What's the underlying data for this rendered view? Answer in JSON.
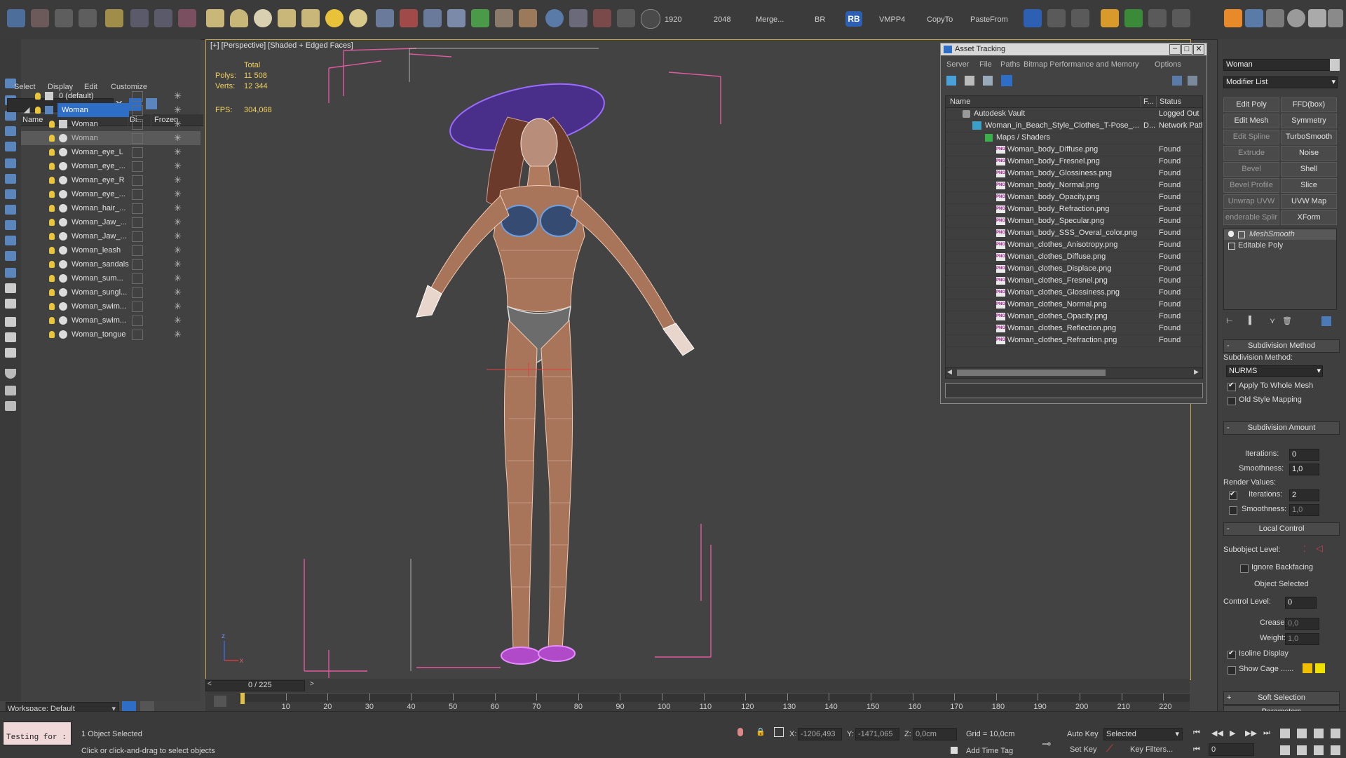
{
  "toolbar": {
    "res_a": "1920",
    "res_b": "2048",
    "merge": "Merge...",
    "br": "BR",
    "rb": "RB",
    "vmpp": "VMPP4",
    "copyto": "CopyTo",
    "pastefrom": "PasteFrom"
  },
  "scene_explorer": {
    "menu": [
      "Select",
      "Display",
      "Edit",
      "Customize"
    ],
    "col_name": "Name",
    "col_display": "Di...",
    "col_frozen": "Frozen",
    "rows": [
      {
        "name": "0 (default)"
      },
      {
        "name": "Woman"
      },
      {
        "name": "Woman"
      },
      {
        "name": "Woman"
      },
      {
        "name": "Woman_eye_L"
      },
      {
        "name": "Woman_eye_..."
      },
      {
        "name": "Woman_eye_R"
      },
      {
        "name": "Woman_eye_..."
      },
      {
        "name": "Woman_hair_..."
      },
      {
        "name": "Woman_Jaw_..."
      },
      {
        "name": "Woman_Jaw_..."
      },
      {
        "name": "Woman_leash"
      },
      {
        "name": "Woman_sandals"
      },
      {
        "name": "Woman_sum..."
      },
      {
        "name": "Woman_sungl..."
      },
      {
        "name": "Woman_swim..."
      },
      {
        "name": "Woman_swim..."
      },
      {
        "name": "Woman_tongue"
      }
    ],
    "workspace": "Workspace: Default"
  },
  "viewport": {
    "label": "[+] [Perspective] [Shaded + Edged Faces]",
    "stat_total": "Total",
    "polys_label": "Polys:",
    "polys_value": "11 508",
    "verts_label": "Verts:",
    "verts_value": "12 344",
    "fps_label": "FPS:",
    "fps_value": "304,068",
    "axis_z": "z",
    "axis_x": "x"
  },
  "asset_tracking": {
    "title": "Asset Tracking",
    "menu": [
      "Server",
      "File",
      "Paths",
      "Bitmap Performance and Memory",
      "Options"
    ],
    "col_name": "Name",
    "col_f": "F...",
    "col_status": "Status",
    "vault": {
      "name": "Autodesk Vault",
      "status": "Logged Out"
    },
    "file": {
      "name": "Woman_in_Beach_Style_Clothes_T-Pose_...",
      "f": "D...",
      "status": "Network Path"
    },
    "maps": "Maps / Shaders",
    "png_label": "PNG",
    "assets": [
      {
        "name": "Woman_body_Diffuse.png",
        "status": "Found"
      },
      {
        "name": "Woman_body_Fresnel.png",
        "status": "Found"
      },
      {
        "name": "Woman_body_Glossiness.png",
        "status": "Found"
      },
      {
        "name": "Woman_body_Normal.png",
        "status": "Found"
      },
      {
        "name": "Woman_body_Opacity.png",
        "status": "Found"
      },
      {
        "name": "Woman_body_Refraction.png",
        "status": "Found"
      },
      {
        "name": "Woman_body_Specular.png",
        "status": "Found"
      },
      {
        "name": "Woman_body_SSS_Overal_color.png",
        "status": "Found"
      },
      {
        "name": "Woman_clothes_Anisotropy.png",
        "status": "Found"
      },
      {
        "name": "Woman_clothes_Diffuse.png",
        "status": "Found"
      },
      {
        "name": "Woman_clothes_Displace.png",
        "status": "Found"
      },
      {
        "name": "Woman_clothes_Fresnel.png",
        "status": "Found"
      },
      {
        "name": "Woman_clothes_Glossiness.png",
        "status": "Found"
      },
      {
        "name": "Woman_clothes_Normal.png",
        "status": "Found"
      },
      {
        "name": "Woman_clothes_Opacity.png",
        "status": "Found"
      },
      {
        "name": "Woman_clothes_Reflection.png",
        "status": "Found"
      },
      {
        "name": "Woman_clothes_Refraction.png",
        "status": "Found"
      }
    ]
  },
  "command_panel": {
    "object_name": "Woman",
    "modifier_list": "Modifier List",
    "buttons": [
      "Edit Poly",
      "FFD(box)",
      "Edit Mesh",
      "Symmetry",
      "Edit Spline",
      "TurboSmooth",
      "Extrude",
      "Noise",
      "Bevel",
      "Shell",
      "Bevel Profile",
      "Slice",
      "Unwrap UVW",
      "UVW Map",
      "enderable Splir",
      "XForm"
    ],
    "stack": [
      "MeshSmooth",
      "Editable Poly"
    ],
    "subdiv_method_title": "Subdivision Method",
    "subdiv_method_label": "Subdivision Method:",
    "subdiv_method_value": "NURMS",
    "apply_whole_mesh": "Apply To Whole Mesh",
    "old_style_mapping": "Old Style Mapping",
    "subdiv_amount_title": "Subdivision Amount",
    "iterations_label": "Iterations:",
    "iterations_value": "0",
    "smoothness_label": "Smoothness:",
    "smoothness_value": "1,0",
    "render_values": "Render Values:",
    "r_iterations_label": "Iterations:",
    "r_iterations_value": "2",
    "r_smoothness_label": "Smoothness:",
    "r_smoothness_value": "1,0",
    "local_control_title": "Local Control",
    "subobject_level": "Subobject Level:",
    "ignore_backfacing": "Ignore Backfacing",
    "object_selected": "Object Selected",
    "control_level_label": "Control Level:",
    "control_level_value": "0",
    "crease_label": "Crease:",
    "crease_value": "0,0",
    "weight_label": "Weight:",
    "weight_value": "1,0",
    "isoline_display": "Isoline Display",
    "show_cage": "Show Cage ......",
    "soft_selection_title": "Soft Selection",
    "parameters_title": "Parameters"
  },
  "timeline": {
    "frame_counter": "0 / 225",
    "ticks": [
      "10",
      "20",
      "30",
      "40",
      "50",
      "60",
      "70",
      "80",
      "90",
      "100",
      "110",
      "120",
      "130",
      "140",
      "150",
      "160",
      "170",
      "180",
      "190",
      "200",
      "210",
      "220"
    ]
  },
  "status_bar": {
    "maxscript": "Testing for :",
    "selection_info": "1 Object Selected",
    "prompt": "Click or click-and-drag to select objects",
    "x_label": "X:",
    "x_value": "-1206,493",
    "y_label": "Y:",
    "y_value": "-1471,065",
    "z_label": "Z:",
    "z_value": "0,0cm",
    "grid": "Grid = 10,0cm",
    "add_time_tag": "Add Time Tag",
    "auto_key": "Auto Key",
    "set_key": "Set Key",
    "selected_dropdown": "Selected",
    "key_filters": "Key Filters...",
    "frame_field": "0"
  },
  "colors": {
    "accent": "#2f6ec7",
    "viewport_border": "#c8a640",
    "wireframe": "#f1c9b2",
    "selection_box": "#e05aa0"
  }
}
